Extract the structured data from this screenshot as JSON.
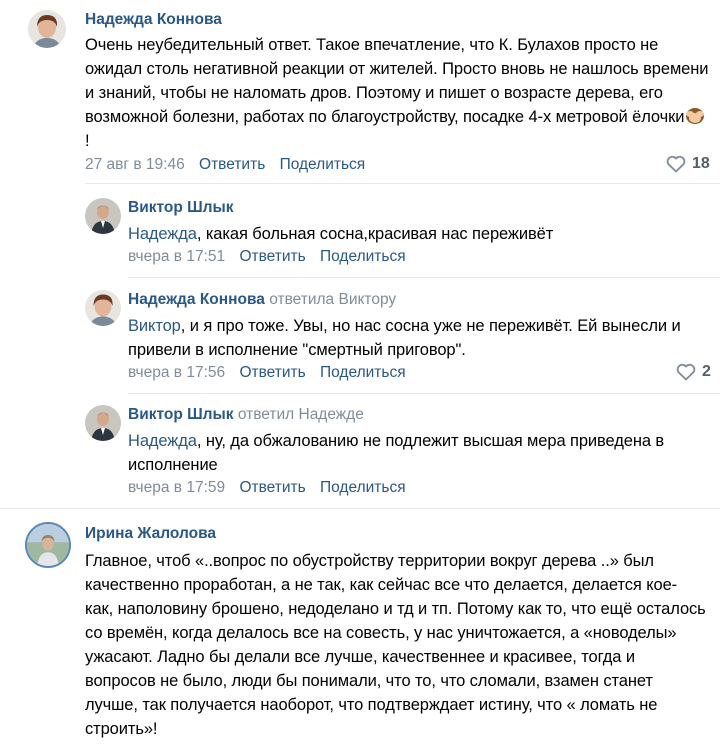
{
  "comments": [
    {
      "author": "Надежда Коннова",
      "text": "Очень неубедительный ответ. Такое впечатление, что К. Булахов просто не ожидал столь негативной реакции от жителей. Просто вновь не нашлось времени и знаний, чтобы не наломать дров. Поэтому и пишет о возрасте дерева, его возможной болезни, работах по благоустройству, посадке 4-х метровой ёлочки",
      "text_end": "!",
      "emoji": "see-no-evil-monkey-emoji",
      "date": "27 авг в 19:46",
      "reply": "Ответить",
      "share": "Поделиться",
      "likes": "18"
    },
    {
      "author": "Виктор Шлык",
      "mention": "Надежда",
      "text": ", какая больная сосна,красивая нас переживёт",
      "date": "вчера в 17:51",
      "reply": "Ответить",
      "share": "Поделиться"
    },
    {
      "author": "Надежда Коннова",
      "replied_to": "ответила Виктору",
      "mention": "Виктор",
      "text": ", и я про тоже. Увы, но нас сосна уже не переживёт. Ей вынесли и привели в исполнение \"смертный приговор\".",
      "date": "вчера в 17:56",
      "reply": "Ответить",
      "share": "Поделиться",
      "likes": "2"
    },
    {
      "author": "Виктор Шлык",
      "replied_to": "ответил Надежде",
      "mention": "Надежда",
      "text": ", ну, да обжалованию не подлежит высшая мера приведена в исполнение",
      "date": "вчера в 17:59",
      "reply": "Ответить",
      "share": "Поделиться"
    },
    {
      "author": "Ирина Жалолова",
      "text": "Главное, чтоб «..вопрос по обустройству территории вокруг дерева ..» был качественно проработан, а не так, как сейчас все что делается, делается кое- как, наполовину брошено, недоделано и тд и тп. Потому как то, что ещё осталось со времён, когда делалось все на совесть, у нас уничтожается, а «новоделы» ужасают. Ладно бы делали все лучше, качественнее и красивее, тогда и вопросов не было, люди бы понимали, что то, что сломали, взамен станет лучше, так получается наоборот, что подтверждает истину, что « ломать не строить»!"
    }
  ],
  "colors": {
    "link": "#2a5885",
    "muted": "#818c99",
    "separator": "#e7e8ec"
  }
}
